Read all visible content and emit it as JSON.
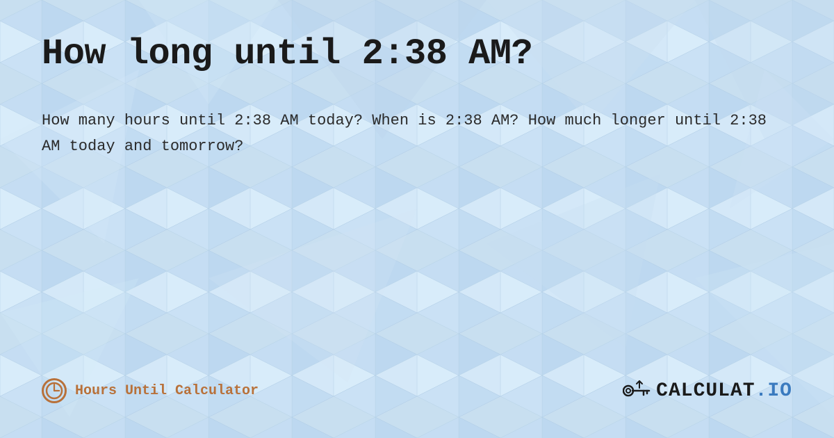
{
  "page": {
    "title": "How long until 2:38 AM?",
    "description": "How many hours until 2:38 AM today? When is 2:38 AM? How much longer until 2:38 AM today and tomorrow?",
    "footer": {
      "label": "Hours Until Calculator",
      "brand": "CALCULAT.IO"
    }
  },
  "colors": {
    "background": "#c8dff0",
    "title": "#1a1a1a",
    "description": "#2a2a2a",
    "accent": "#b8713a",
    "brand_blue": "#3a7abf"
  }
}
